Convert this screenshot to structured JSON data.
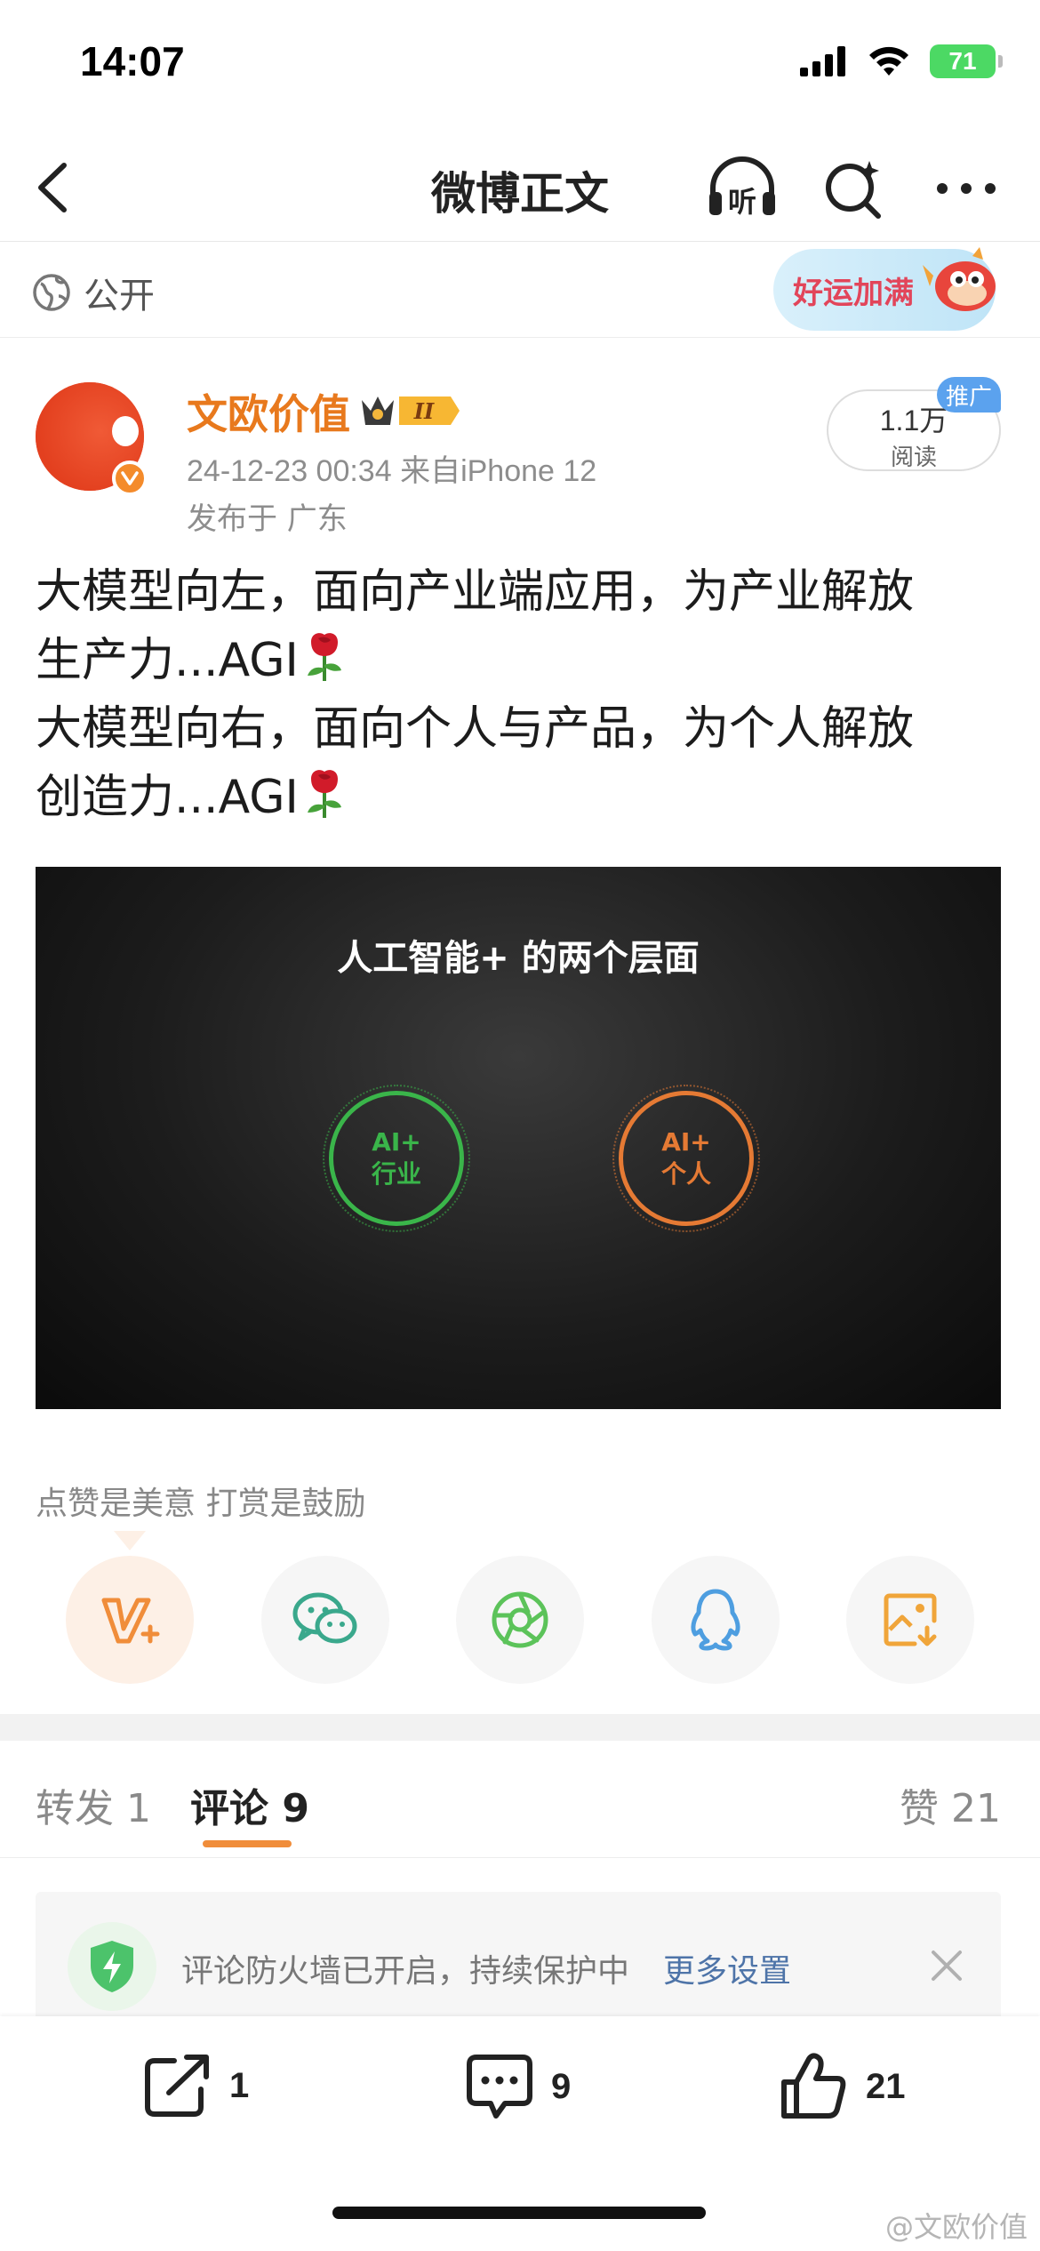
{
  "status_bar": {
    "time": "14:07",
    "battery": "71"
  },
  "nav": {
    "title": "微博正文",
    "listen_icon_label": "听"
  },
  "visibility": {
    "label": "公开",
    "banner_text": "好运加满"
  },
  "post": {
    "author": "文欧价值",
    "meta": "24-12-23 00:34  来自iPhone 12",
    "location": "发布于 广东",
    "read_count": "1.1万",
    "read_label": "阅读",
    "promo_tag": "推广",
    "lines": [
      "大模型向左，面向产业端应用，为产业解放",
      "生产力...AGI",
      "大模型向右，面向个人与产品，为个人解放",
      "创造力...AGI"
    ],
    "image": {
      "title": "人工智能+ 的两个层面",
      "left_circle": [
        "AI+",
        "行业"
      ],
      "right_circle": [
        "AI+",
        "个人"
      ]
    }
  },
  "reward": {
    "text": "点赞是美意  打赏是鼓励"
  },
  "tabs": {
    "repost": "转发 1",
    "comment": "评论 9",
    "like": "赞 21"
  },
  "firewall": {
    "text": "评论防火墙已开启，持续保护中",
    "link": "更多设置"
  },
  "actions": {
    "repost_count": "1",
    "comment_count": "9",
    "like_count": "21"
  },
  "watermark": "@文欧价值",
  "colors": {
    "accent_orange": "#e8791d",
    "green": "#3ab54a",
    "orange": "#e57a34",
    "link_blue": "#4e74a8"
  }
}
